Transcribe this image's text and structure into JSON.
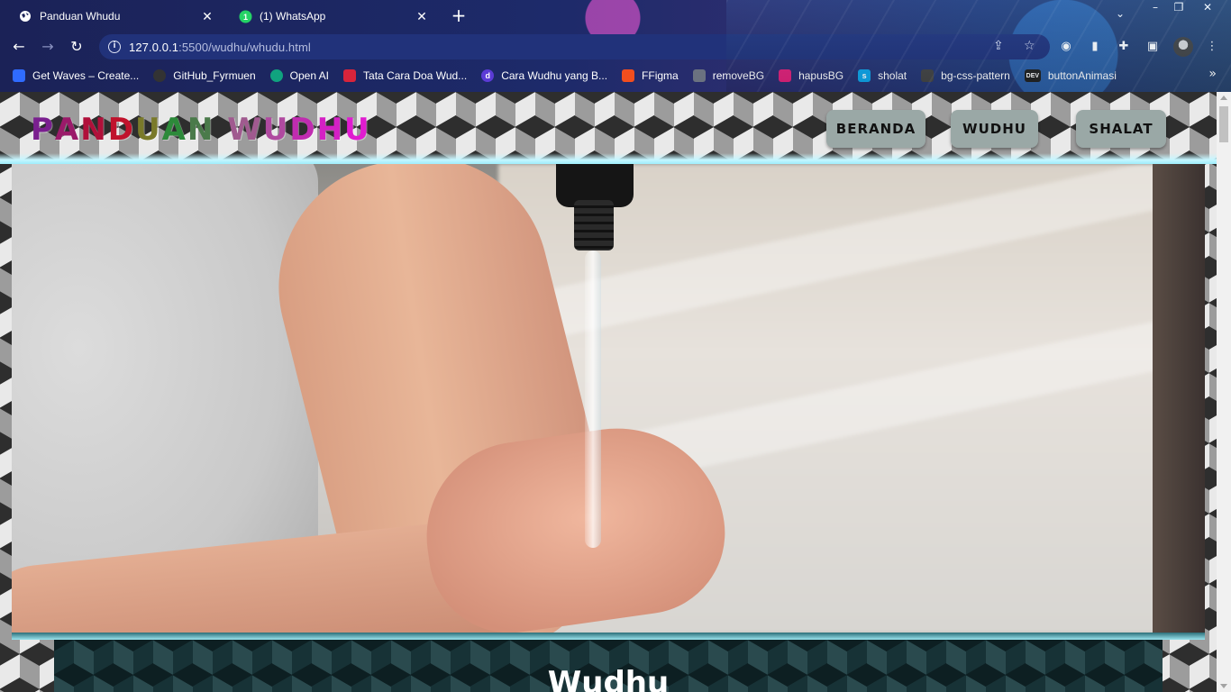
{
  "browser": {
    "tabs": [
      {
        "title": "Panduan Whudu",
        "icon": "globe-icon",
        "active": true
      },
      {
        "title": "(1) WhatsApp",
        "icon": "whatsapp-icon",
        "badge": "1",
        "active": false
      }
    ],
    "new_tab": "+",
    "url": {
      "host": "127.0.0.1",
      "rest": ":5500/wudhu/whudu.html"
    },
    "bookmarks": [
      {
        "label": "Get Waves – Create...",
        "icon_color": "#2f6bff"
      },
      {
        "label": "GitHub_Fyrmuen",
        "icon_color": "#333333"
      },
      {
        "label": "Open AI",
        "icon_color": "#10a37f"
      },
      {
        "label": "Tata Cara Doa Wud...",
        "icon_color": "#d8243b"
      },
      {
        "label": "Cara Wudhu yang B...",
        "icon_color": "#5b3bd6"
      },
      {
        "label": "FFigma",
        "icon_color": "#f24e1e"
      },
      {
        "label": "removeBG",
        "icon_color": "#6b7280"
      },
      {
        "label": "hapusBG",
        "icon_color": "#e2217a"
      },
      {
        "label": "sholat",
        "icon_color": "#0ea5e9"
      },
      {
        "label": "bg-css-pattern",
        "icon_color": "#444444"
      },
      {
        "label": "buttonAnimasi",
        "icon_color": "#222222",
        "icon_text": "DEV"
      }
    ]
  },
  "site": {
    "logo": [
      {
        "ch": "P",
        "color": "#7a1f8f"
      },
      {
        "ch": "A",
        "color": "#9b1a6a"
      },
      {
        "ch": "N",
        "color": "#b0103a"
      },
      {
        "ch": "D",
        "color": "#c0122c"
      },
      {
        "ch": "U",
        "color": "#7a7a2a"
      },
      {
        "ch": "A",
        "color": "#2d8a3a"
      },
      {
        "ch": "N",
        "color": "#4a7a4a"
      },
      {
        "ch": " ",
        "color": "#000000"
      },
      {
        "ch": "W",
        "color": "#a05a8f"
      },
      {
        "ch": "U",
        "color": "#b04aa0"
      },
      {
        "ch": "D",
        "color": "#c02cb0"
      },
      {
        "ch": "H",
        "color": "#d420c4"
      },
      {
        "ch": "U",
        "color": "#e01cd0"
      }
    ],
    "nav": [
      "BERANDA",
      "WUDHU",
      "SHALAT"
    ],
    "section_title": "Wudhu"
  }
}
